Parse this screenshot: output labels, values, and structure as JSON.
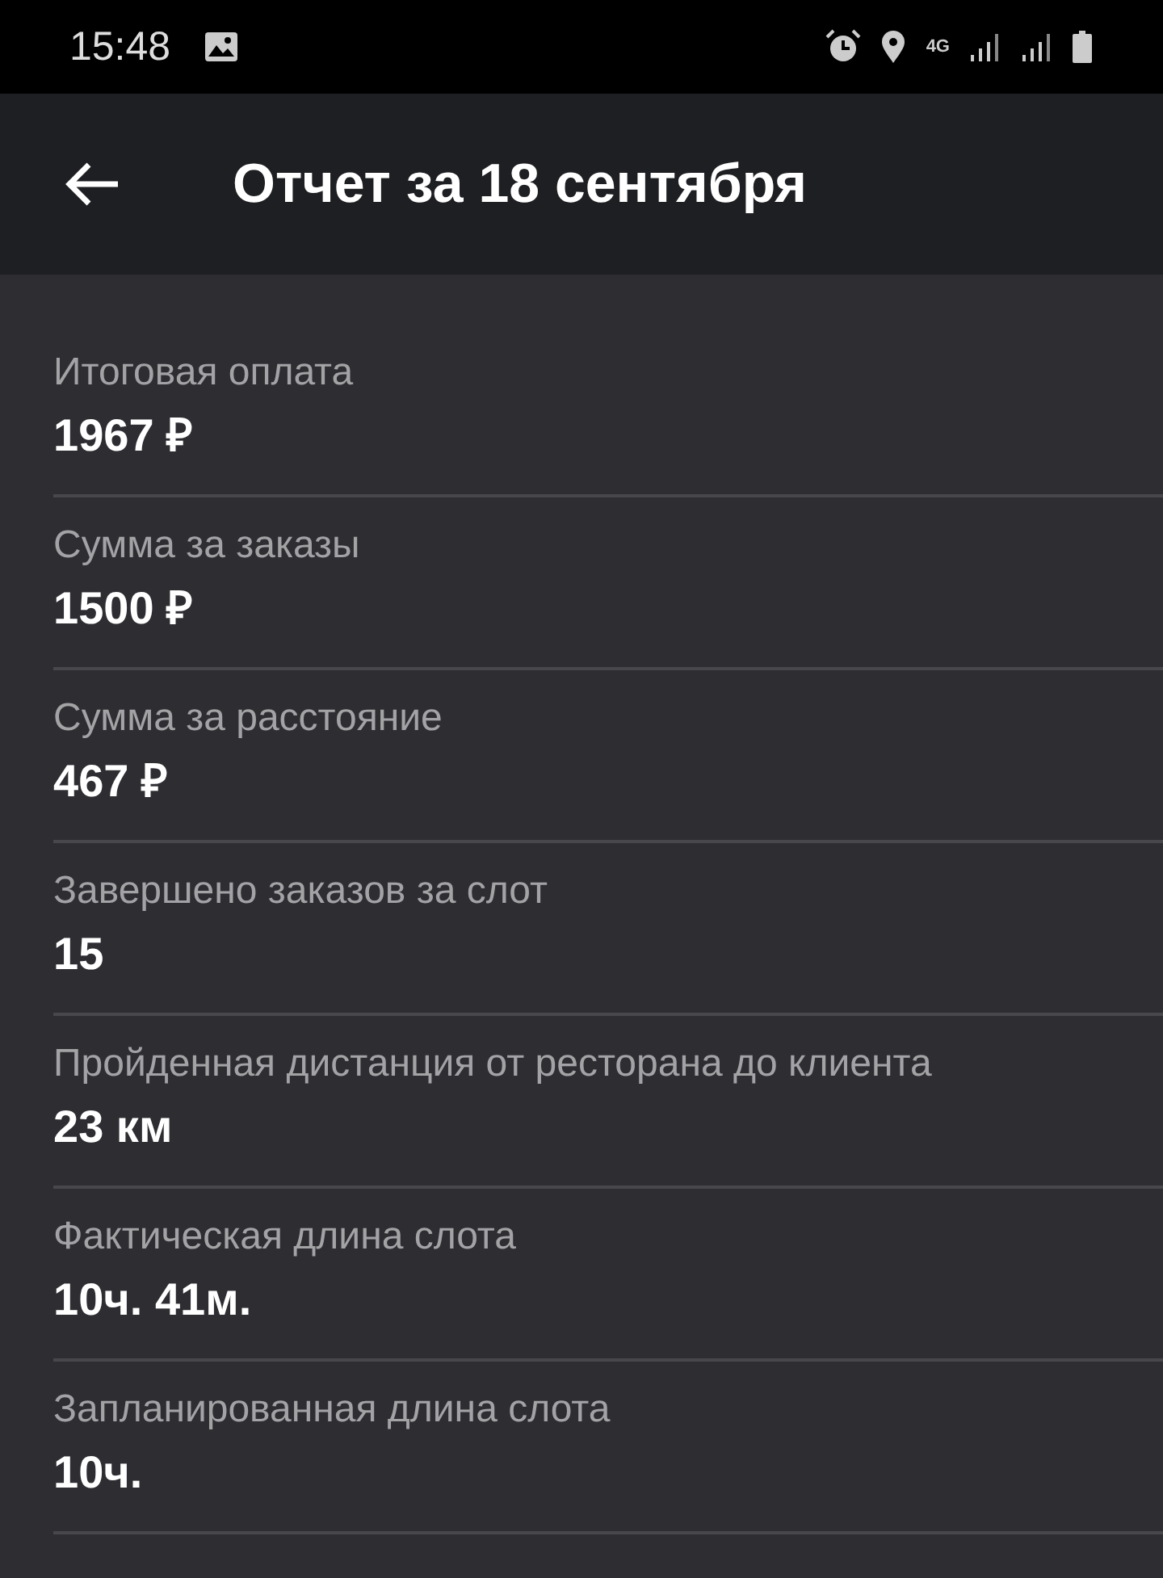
{
  "status_bar": {
    "time": "15:48",
    "network": "4G"
  },
  "app_bar": {
    "title": "Отчет за 18 сентября"
  },
  "items": [
    {
      "label": "Итоговая оплата",
      "value": "1967 ₽"
    },
    {
      "label": "Сумма за заказы",
      "value": "1500 ₽"
    },
    {
      "label": "Сумма за расстояние",
      "value": "467 ₽"
    },
    {
      "label": "Завершено заказов за слот",
      "value": "15"
    },
    {
      "label": "Пройденная дистанция от ресторана до клиента",
      "value": "23 км"
    },
    {
      "label": "Фактическая длина слота",
      "value": "10ч. 41м."
    },
    {
      "label": "Запланированная длина слота",
      "value": "10ч."
    }
  ]
}
